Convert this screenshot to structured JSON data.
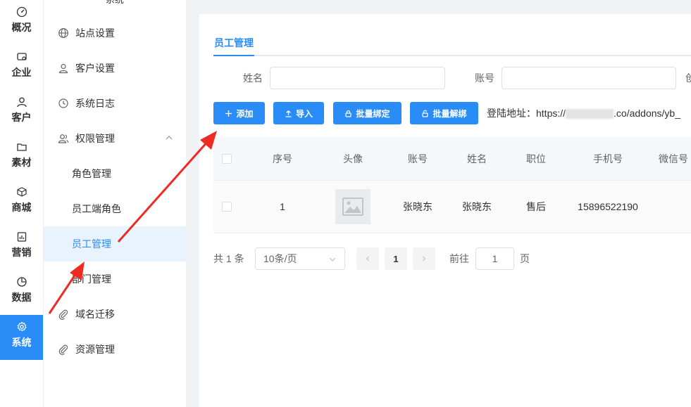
{
  "rail": {
    "items": [
      {
        "label": "概况",
        "icon": "dashboard-icon"
      },
      {
        "label": "企业",
        "icon": "enterprise-icon"
      },
      {
        "label": "客户",
        "icon": "customer-icon"
      },
      {
        "label": "素材",
        "icon": "folder-icon"
      },
      {
        "label": "商城",
        "icon": "box-icon"
      },
      {
        "label": "营销",
        "icon": "marketing-icon"
      },
      {
        "label": "数据",
        "icon": "pie-chart-icon"
      },
      {
        "label": "系统",
        "icon": "gear-icon"
      }
    ]
  },
  "sidebar": {
    "header": "系统",
    "items": [
      {
        "label": "站点设置",
        "icon": "globe-icon"
      },
      {
        "label": "客户设置",
        "icon": "user-icon"
      },
      {
        "label": "系统日志",
        "icon": "clock-icon"
      },
      {
        "label": "权限管理",
        "icon": "users-icon"
      },
      {
        "label": "角色管理"
      },
      {
        "label": "员工端角色"
      },
      {
        "label": "员工管理"
      },
      {
        "label": "部门管理"
      },
      {
        "label": "域名迁移",
        "icon": "paperclip-icon"
      },
      {
        "label": "资源管理",
        "icon": "paperclip-icon"
      }
    ]
  },
  "main": {
    "tab": "员工管理",
    "filters": {
      "name_label": "姓名",
      "account_label": "账号",
      "third_label": "创"
    },
    "buttons": {
      "add": "添加",
      "import": "导入",
      "bind": "批量绑定",
      "unbind": "批量解绑"
    },
    "login_url_prefix": "登陆地址：https://",
    "login_url_suffix": ".co/addons/yb_",
    "table": {
      "headers": [
        "序号",
        "头像",
        "账号",
        "姓名",
        "职位",
        "手机号",
        "微信号"
      ],
      "rows": [
        {
          "index": "1",
          "account": "张晓东",
          "name": "张晓东",
          "position": "售后",
          "phone": "15896522190"
        }
      ]
    },
    "pagination": {
      "total": "共 1 条",
      "page_size": "10条/页",
      "current_page": "1",
      "goto_label": "前往",
      "goto_value": "1",
      "unit": "页"
    }
  },
  "colors": {
    "accent": "#2a8cf7",
    "annotation": "#ee2a24"
  }
}
